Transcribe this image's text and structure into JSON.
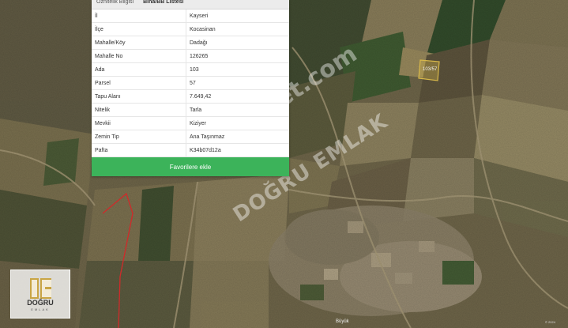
{
  "tabs": [
    {
      "label": "Öznitelik Bilgisi"
    },
    {
      "label": "Bina/BB Listesi"
    }
  ],
  "parcel_rows": [
    {
      "label": "İl",
      "value": "Kayseri"
    },
    {
      "label": "İlçe",
      "value": "Kocasinan"
    },
    {
      "label": "Mahalle/Köy",
      "value": "Dadağı"
    },
    {
      "label": "Mahalle No",
      "value": "126265"
    },
    {
      "label": "Ada",
      "value": "103"
    },
    {
      "label": "Parsel",
      "value": "57"
    },
    {
      "label": "Tapu Alanı",
      "value": "7.649,42"
    },
    {
      "label": "Nitelik",
      "value": "Tarla"
    },
    {
      "label": "Mevkii",
      "value": "Kiziyer"
    },
    {
      "label": "Zemin Tip",
      "value": "Ana Taşınmaz"
    },
    {
      "label": "Pafta",
      "value": "K34b07d12a"
    }
  ],
  "favorite_button": "Favorilere ekle",
  "map": {
    "parcel_label": "103/57",
    "place_label": "Büyük",
    "attribution": "© 2024"
  },
  "watermark": {
    "line1": "emlakjet.com",
    "line2": "DOĞRU EMLAK"
  },
  "logo": {
    "name": "DOĞRU",
    "sub": "EMLAK"
  },
  "colors": {
    "button": "#3cb35a",
    "parcel_outline": "#d8b84a",
    "boundary": "#d02a2a"
  }
}
